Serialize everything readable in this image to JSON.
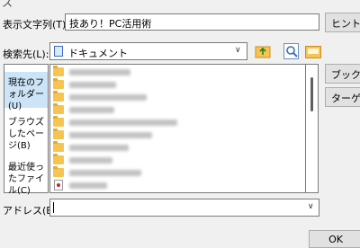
{
  "title_glyph": "ス",
  "display_label": "表示文字列(T):",
  "display_value": "技あり！PC活用術",
  "hint_button": "ヒント",
  "lookin_label": "検索先(L):",
  "lookin_value": "ドキュメント",
  "places": [
    {
      "label": "現在のフォルダー(U)"
    },
    {
      "label": "ブラウズしたページ(B)"
    },
    {
      "label": "最近使ったファイル(C)"
    }
  ],
  "right_buttons": {
    "bookmark": "ブック",
    "target": "ターゲット"
  },
  "files": [
    {
      "type": "folder"
    },
    {
      "type": "folder"
    },
    {
      "type": "folder"
    },
    {
      "type": "folder"
    },
    {
      "type": "folder"
    },
    {
      "type": "folder"
    },
    {
      "type": "folder"
    },
    {
      "type": "folder"
    },
    {
      "type": "folder"
    },
    {
      "type": "doc"
    }
  ],
  "address_label": "アドレス(E):",
  "address_value": "",
  "ok_button": "OK"
}
